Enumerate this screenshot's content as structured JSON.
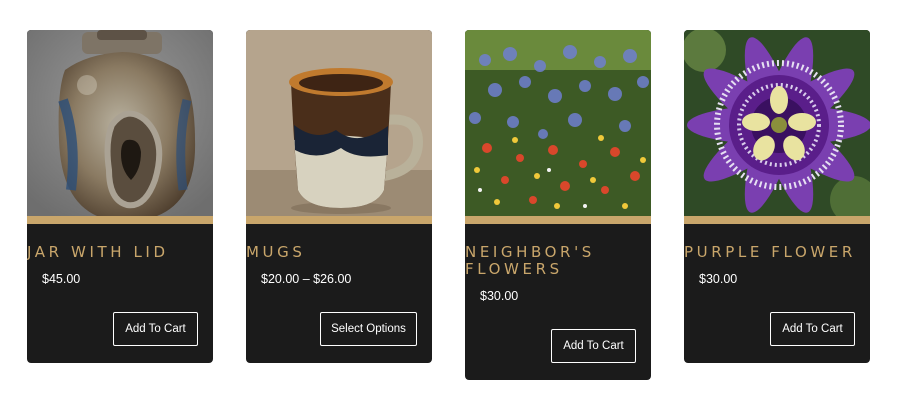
{
  "products": [
    {
      "name": "Jar With Lid",
      "price": "$45.00",
      "button": "Add To Cart",
      "image": "stoneware jar with lid"
    },
    {
      "name": "Mugs",
      "price": "$20.00 – $26.00",
      "button": "Select Options",
      "image": "glazed mug"
    },
    {
      "name": "Neighbor's Flowers",
      "price": "$30.00",
      "button": "Add To Cart",
      "image": "flower garden"
    },
    {
      "name": "Purple Flower",
      "price": "$30.00",
      "button": "Add To Cart",
      "image": "purple passion flower"
    }
  ],
  "colors": {
    "card_bg": "#1b1b1b",
    "accent": "#c9a66b",
    "text": "#ffffff"
  }
}
